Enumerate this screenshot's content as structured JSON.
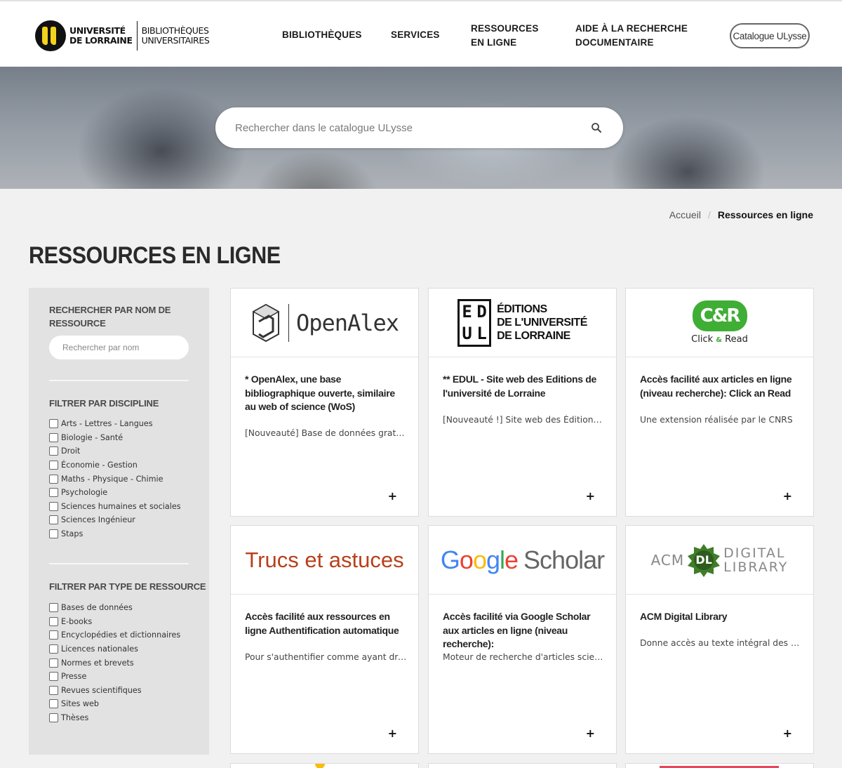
{
  "header": {
    "logo_line1": "UNIVERSITÉ",
    "logo_line2": "DE LORRAINE",
    "logo_line3": "BIBLIOTHÈQUES",
    "logo_line4": "UNIVERSITAIRES",
    "nav": [
      {
        "line1": "BIBLIOTHÈQUES",
        "line2": ""
      },
      {
        "line1": "SERVICES",
        "line2": ""
      },
      {
        "line1": "RESSOURCES",
        "line2": "EN LIGNE"
      },
      {
        "line1": "AIDE À LA RECHERCHE",
        "line2": "DOCUMENTAIRE"
      }
    ],
    "catalogue_button": "Catalogue ULysse"
  },
  "hero": {
    "search_placeholder": "Rechercher dans le catalogue ULysse",
    "search_icon": "search-icon"
  },
  "breadcrumb": {
    "home": "Accueil",
    "separator": "/",
    "current": "Ressources en ligne"
  },
  "page_title": "RESSOURCES EN LIGNE",
  "sidebar": {
    "search_heading": "RECHERCHER PAR NOM DE RESSOURCE",
    "search_placeholder": "Rechercher par nom",
    "discipline_heading": "FILTRER PAR DISCIPLINE",
    "disciplines": [
      "Arts - Lettres - Langues",
      "Biologie - Santé",
      "Droit",
      "Économie - Gestion",
      "Maths - Physique - Chimie",
      "Psychologie",
      "Sciences humaines et sociales",
      "Sciences Ingénieur",
      "Staps"
    ],
    "type_heading": "FILTRER PAR TYPE DE RESSOURCE",
    "types": [
      "Bases de données",
      "E-books",
      "Encyclopédies et dictionnaires",
      "Licences nationales",
      "Normes et brevets",
      "Presse",
      "Revues scientifiques",
      "Sites web",
      "Thèses"
    ]
  },
  "cards": [
    {
      "logo_text": "OpenAlex",
      "title": "* OpenAlex, une base bibliographique ouverte, similaire au web of science (WoS)",
      "desc": "[Nouveauté] Base de données gratuite et ouverte",
      "more": "+"
    },
    {
      "logo_mark": [
        "E",
        "D",
        "U",
        "L"
      ],
      "logo_text_lines": [
        "ÉDITIONS",
        "DE L'UNIVERSITÉ",
        "DE LORRAINE"
      ],
      "title": "** EDUL - Site web des Editions de l'université de Lorraine",
      "desc": "[Nouveauté !] Site web des Éditions de l'université",
      "more": "+"
    },
    {
      "logo_badge": "C&R",
      "logo_text_parts": [
        "Click",
        "&",
        "Read"
      ],
      "title": "Accès facilité aux articles en ligne (niveau recherche): Click an Read",
      "desc": "Une extension réalisée par le CNRS",
      "more": "+"
    },
    {
      "logo_text": "Trucs et astuces",
      "title": "Accès facilité aux ressources en ligne Authentification automatique",
      "desc": "Pour s'authentifier comme ayant droit",
      "more": "+"
    },
    {
      "logo_letters": [
        "G",
        "o",
        "o",
        "g",
        "l",
        "e"
      ],
      "logo_text": "Scholar",
      "title": "Accès facilité via Google Scholar aux articles en ligne (niveau recherche):",
      "desc": "Moteur de recherche d'articles scientifiques",
      "more": "+"
    },
    {
      "logo_prefix": "ACM",
      "logo_badge": "DL",
      "logo_text_lines": [
        "DIGITAL",
        "LIBRARY"
      ],
      "title": "ACM Digital Library",
      "desc": "Donne accès au texte intégral des articles",
      "more": "+"
    }
  ],
  "colors": {
    "accent_yellow": "#f2d21b",
    "truc_red": "#b8401c",
    "click_read_green": "#3fae35",
    "acm_green": "#3f7d2a",
    "google_blue": "#4285f4",
    "google_red": "#ea4335",
    "google_yellow": "#fbbc05",
    "google_green": "#34a853"
  }
}
